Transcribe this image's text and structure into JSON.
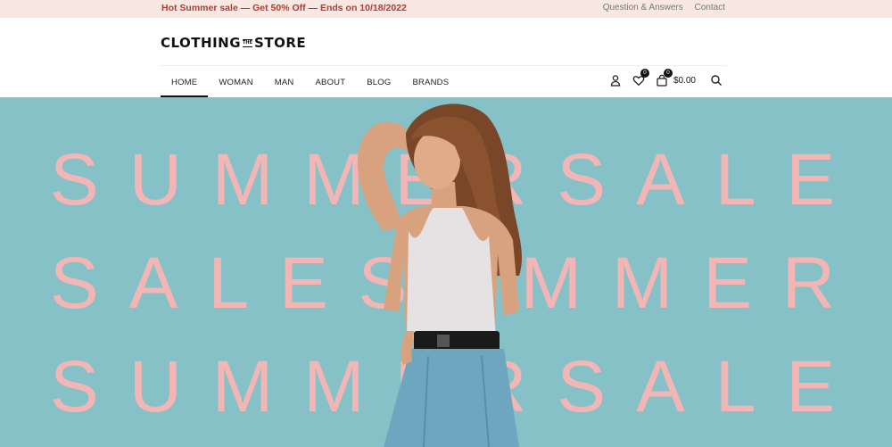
{
  "topbar": {
    "promo": "Hot Summer sale — Get 50% Off — Ends on 10/18/2022",
    "links": [
      "Question & Answers",
      "Contact"
    ]
  },
  "header": {
    "logo": {
      "left": "CLOTHING",
      "middle": "THE",
      "right": "STORE"
    },
    "nav": [
      "HOME",
      "WOMAN",
      "MAN",
      "ABOUT",
      "BLOG",
      "BRANDS"
    ],
    "active_nav": "HOME",
    "icons": [
      "user-icon",
      "heart-icon",
      "bag-icon",
      "search-icon"
    ],
    "wishlist_count": "0",
    "cart_count": "0",
    "cart_total": "$0.00"
  },
  "hero": {
    "lines": [
      "SUMMERSALE",
      "SALESUMMER",
      "SUMMERSALE"
    ],
    "background": "#87c1c8",
    "text_color": "#f4b5b5"
  },
  "colors": {
    "promo": "#b23b33",
    "topbar_bg": "#f8e8e1"
  }
}
